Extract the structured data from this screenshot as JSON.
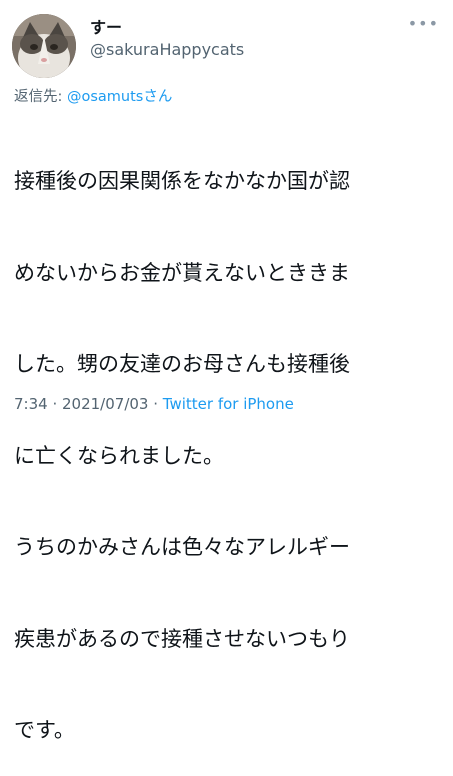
{
  "author": {
    "display_name": "すー",
    "handle": "@sakuraHappycats"
  },
  "reply": {
    "prefix": "返信先: ",
    "mention": "@osamutsさん"
  },
  "tweet": {
    "lines": [
      "接種後の因果関係をなかなか国が認",
      "めないからお金が貰えないとききま",
      "した。甥の友達のお母さんも接種後",
      "に亡くなられました。",
      "うちのかみさんは色々なアレルギー",
      "疾患があるので接種させないつもり",
      "です。"
    ]
  },
  "meta": {
    "time": "7:34",
    "separator": " · ",
    "date": "2021/07/03",
    "source": "Twitter for iPhone"
  },
  "icons": {
    "more": "more-dots-icon",
    "avatar": "cat-avatar"
  },
  "colors": {
    "link": "#1d9bf0",
    "secondary": "#536471",
    "text": "#0f1419"
  }
}
